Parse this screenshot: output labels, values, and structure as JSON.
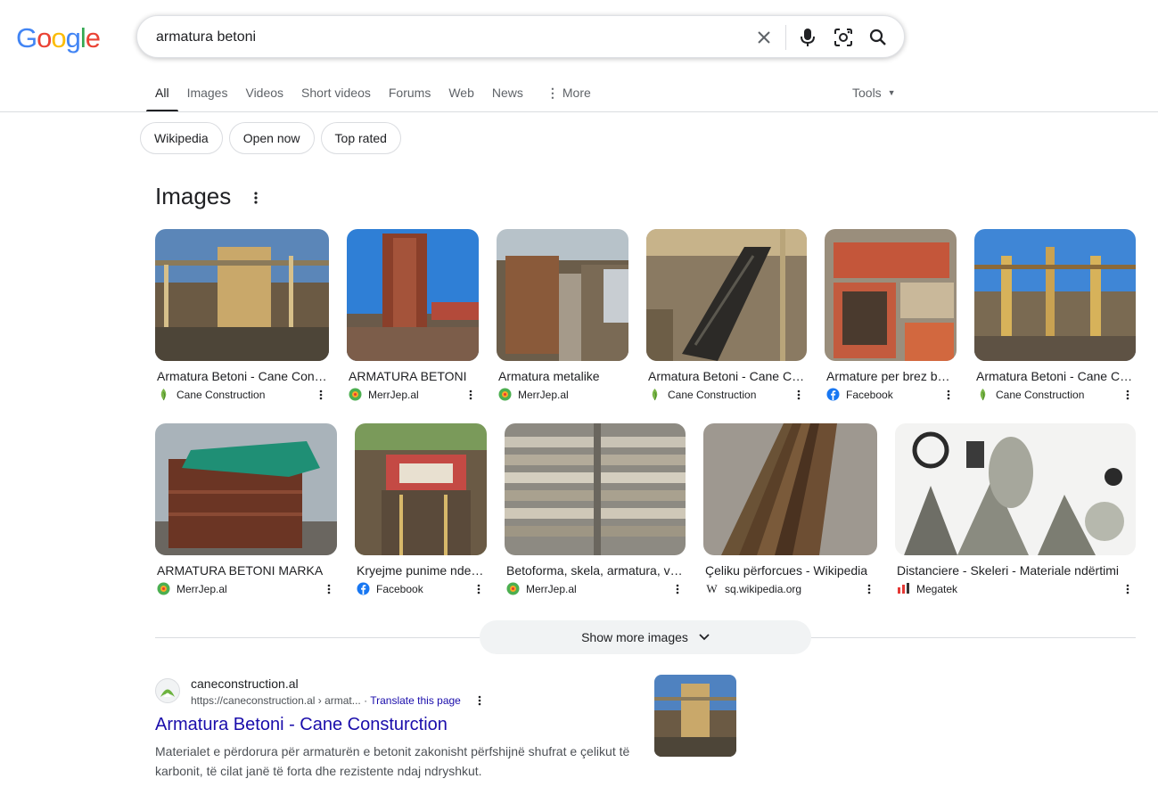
{
  "logo": {
    "letters": [
      "G",
      "o",
      "o",
      "g",
      "l",
      "e"
    ],
    "colors": [
      "#4285F4",
      "#EA4335",
      "#FBBC05",
      "#4285F4",
      "#34A853",
      "#EA4335"
    ]
  },
  "search": {
    "query": "armatura betoni"
  },
  "tabs": [
    {
      "label": "All",
      "active": true
    },
    {
      "label": "Images"
    },
    {
      "label": "Videos"
    },
    {
      "label": "Short videos"
    },
    {
      "label": "Forums"
    },
    {
      "label": "Web"
    },
    {
      "label": "News"
    },
    {
      "label": "More"
    }
  ],
  "tools_label": "Tools",
  "chips": [
    "Wikipedia",
    "Open now",
    "Top rated"
  ],
  "images": {
    "title": "Images",
    "row1": [
      {
        "caption": "Armatura Betoni - Cane Construction",
        "source": "Cane Construction",
        "favicon": "cane-leaf"
      },
      {
        "caption": "ARMATURA BETONI",
        "source": "MerrJep.al",
        "favicon": "merrjep"
      },
      {
        "caption": "Armatura metalike",
        "source": "MerrJep.al",
        "favicon": "merrjep"
      },
      {
        "caption": "Armatura Betoni - Cane Construction",
        "source": "Cane Construction",
        "favicon": "cane-leaf"
      },
      {
        "caption": "Armature per brez betoni",
        "source": "Facebook",
        "favicon": "facebook"
      },
      {
        "caption": "Armatura Betoni - Cane Construction",
        "source": "Cane Construction",
        "favicon": "cane-leaf"
      }
    ],
    "row2": [
      {
        "caption": "ARMATURA BETONI MARKA",
        "source": "MerrJep.al",
        "favicon": "merrjep"
      },
      {
        "caption": "Kryejme punime ndertimi",
        "source": "Facebook",
        "favicon": "facebook"
      },
      {
        "caption": "Betoforma, skela, armatura, veglat",
        "source": "MerrJep.al",
        "favicon": "merrjep"
      },
      {
        "caption": "Çeliku përforcues - Wikipedia",
        "source": "sq.wikipedia.org",
        "favicon": "wikipedia"
      },
      {
        "caption": "Distanciere - Skeleri - Materiale ndërtimi",
        "source": "Megatek",
        "favicon": "megatek"
      }
    ],
    "show_more": "Show more images"
  },
  "result": {
    "site": "caneconstruction.al",
    "url": "https://caneconstruction.al › armat...",
    "translate": "Translate this page",
    "title": "Armatura Betoni - Cane Consturction",
    "snippet": "Materialet e përdorura për armaturën e betonit zakonisht përfshijnë shufrat e çelikut të karbonit, të cilat janë të forta dhe rezistente ndaj ndryshkut."
  },
  "colors": {
    "link": "#1a0dab",
    "text": "#202124",
    "muted": "#4d5156",
    "border": "#dadce0"
  }
}
